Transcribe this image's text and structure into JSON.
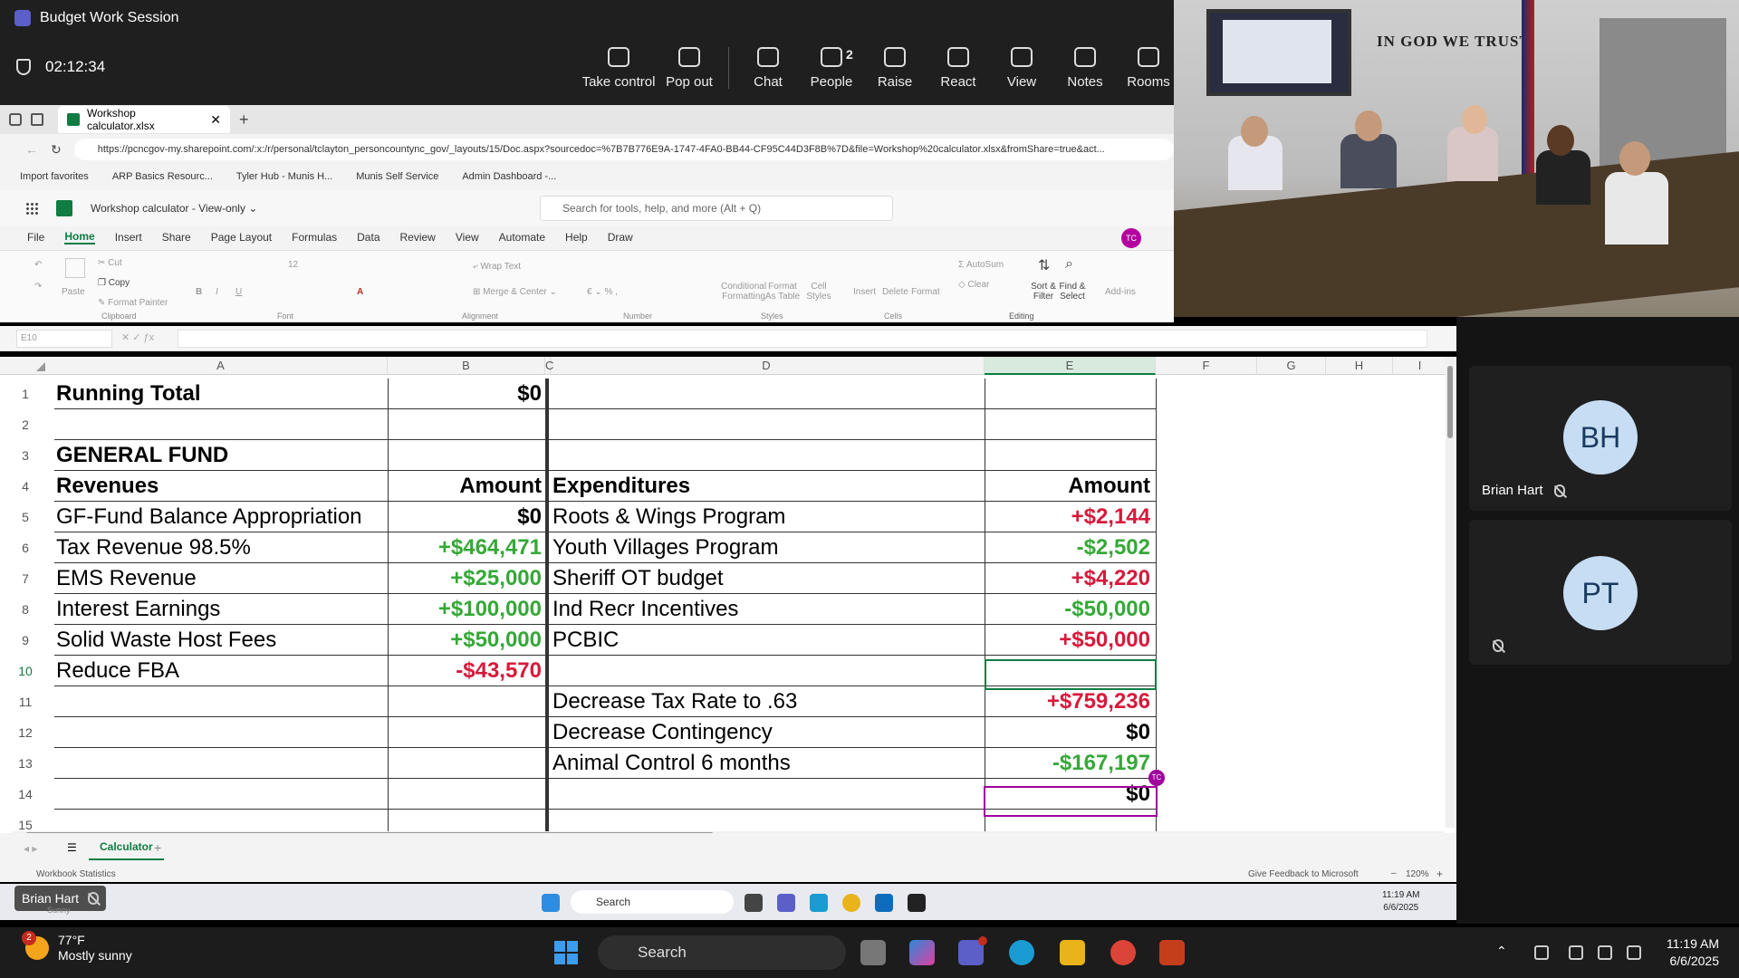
{
  "teams": {
    "window_title": "Budget Work Session",
    "timer": "02:12:34",
    "toolbar": [
      {
        "label": "Take control",
        "icon": "take-control-icon"
      },
      {
        "label": "Pop out",
        "icon": "pop-out-icon"
      },
      {
        "label": "Chat",
        "icon": "chat-icon"
      },
      {
        "label": "People",
        "icon": "people-icon",
        "count": "2"
      },
      {
        "label": "Raise",
        "icon": "raise-hand-icon"
      },
      {
        "label": "React",
        "icon": "react-icon"
      },
      {
        "label": "View",
        "icon": "view-icon"
      },
      {
        "label": "Notes",
        "icon": "notes-icon"
      },
      {
        "label": "Rooms",
        "icon": "rooms-icon"
      }
    ]
  },
  "browser": {
    "tab_title": "Workshop calculator.xlsx",
    "url": "https://pcncgov-my.sharepoint.com/:x:/r/personal/tclayton_personcountync_gov/_layouts/15/Doc.aspx?sourcedoc=%7B7B776E9A-1747-4FA0-BB44-CF95C44D3F8B%7D&file=Workshop%20calculator.xlsx&fromShare=true&act...",
    "favorites": [
      "Import favorites",
      "ARP Basics Resourc...",
      "Tyler Hub - Munis H...",
      "Munis Self Service",
      "Admin Dashboard -..."
    ]
  },
  "excel": {
    "file_title": "Workshop calculator",
    "view_mode": "View-only",
    "search_placeholder": "Search for tools, help, and more (Alt + Q)",
    "menu": [
      "File",
      "Home",
      "Insert",
      "Share",
      "Page Layout",
      "Formulas",
      "Data",
      "Review",
      "View",
      "Automate",
      "Help",
      "Draw"
    ],
    "active_menu": "Home",
    "user_initials": "TC",
    "ribbon": {
      "cut": "Cut",
      "copy": "Copy",
      "format_painter": "Format Painter",
      "clipboard": "Clipboard",
      "wrap_text": "Wrap Text",
      "merge_center": "Merge & Center",
      "font_size": "12",
      "conditional_formatting": "Conditional Formatting",
      "format_as_table": "Format As Table",
      "cell_styles": "Cell Styles",
      "insert": "Insert",
      "delete": "Delete",
      "format": "Format",
      "autosum": "AutoSum",
      "clear": "Clear",
      "sort_filter": "Sort & Filter",
      "find_select": "Find & Select",
      "editing": "Editing",
      "addins": "Add-ins",
      "font": "Font",
      "alignment": "Alignment",
      "number": "Number",
      "styles": "Styles",
      "cells": "Cells",
      "undo": "Undo",
      "paste": "Paste"
    },
    "name_box": "E10",
    "columns": [
      "A",
      "B",
      "C",
      "D",
      "E",
      "F",
      "G",
      "H",
      "I"
    ],
    "selected_column": "E",
    "rows": [
      {
        "n": "1",
        "a": "Running Total",
        "a_bold": true,
        "b": "$0",
        "b_bold": true,
        "d": "",
        "e": ""
      },
      {
        "n": "2",
        "a": "",
        "b": "",
        "d": "",
        "e": ""
      },
      {
        "n": "3",
        "a": "GENERAL FUND",
        "a_bold": true,
        "b": "",
        "d": "",
        "e": ""
      },
      {
        "n": "4",
        "a": "Revenues",
        "a_bold": true,
        "b": "Amount",
        "b_bold": true,
        "d": "Expenditures",
        "d_bold": true,
        "e": "Amount",
        "e_bold": true
      },
      {
        "n": "5",
        "a": "GF-Fund Balance Appropriation",
        "b": "$0",
        "b_style": "zero",
        "d": "Roots & Wings Program",
        "e": "+$2,144",
        "e_style": "neg"
      },
      {
        "n": "6",
        "a": "Tax Revenue 98.5%",
        "b": "+$464,471",
        "b_style": "pos",
        "d": "Youth Villages Program",
        "e": "-$2,502",
        "e_style": "pos"
      },
      {
        "n": "7",
        "a": "EMS Revenue",
        "b": "+$25,000",
        "b_style": "pos",
        "d": "Sheriff OT budget",
        "e": "+$4,220",
        "e_style": "neg"
      },
      {
        "n": "8",
        "a": "Interest Earnings",
        "b": "+$100,000",
        "b_style": "pos",
        "d": "Ind Recr Incentives",
        "e": "-$50,000",
        "e_style": "pos"
      },
      {
        "n": "9",
        "a": "Solid Waste Host Fees",
        "b": "+$50,000",
        "b_style": "pos",
        "d": "PCBIC",
        "e": "+$50,000",
        "e_style": "neg"
      },
      {
        "n": "10",
        "a": "Reduce FBA",
        "b": "-$43,570",
        "b_style": "neg",
        "d": "",
        "e": ""
      },
      {
        "n": "11",
        "a": "",
        "b": "",
        "d": "Decrease Tax Rate to .63",
        "e": "+$759,236",
        "e_style": "neg"
      },
      {
        "n": "12",
        "a": "",
        "b": "",
        "d": "Decrease Contingency",
        "e": "$0",
        "e_style": "zero"
      },
      {
        "n": "13",
        "a": "",
        "b": "",
        "d": "Animal Control 6 months",
        "e": "-$167,197",
        "e_style": "pos"
      },
      {
        "n": "14",
        "a": "",
        "b": "",
        "d": "",
        "e": "$0",
        "e_style": "zero"
      },
      {
        "n": "15",
        "a": "",
        "b": "",
        "d": "",
        "e": ""
      }
    ],
    "selected_row": "10",
    "sheet_tab": "Calculator",
    "status_left": "Workbook Statistics",
    "status_feedback": "Give Feedback to Microsoft",
    "zoom": "120%"
  },
  "inner_taskbar": {
    "search": "Search",
    "time": "11:19 AM",
    "date": "6/6/2025",
    "weather_label": "Sunny"
  },
  "meeting": {
    "motto": "IN GOD WE TRUST",
    "participants": [
      {
        "initials": "BH",
        "name": "Brian Hart"
      },
      {
        "initials": "PT",
        "name": ""
      }
    ],
    "active_speaker": "Brian Hart"
  },
  "windows_taskbar": {
    "notifications": "2",
    "temperature": "77°F",
    "condition": "Mostly sunny",
    "search": "Search",
    "time": "11:19 AM",
    "date": "6/6/2025"
  },
  "colors": {
    "positive": "#36a838",
    "negative": "#d7193b",
    "excel_green": "#107c41",
    "teams_bg": "#1f1f1f"
  }
}
